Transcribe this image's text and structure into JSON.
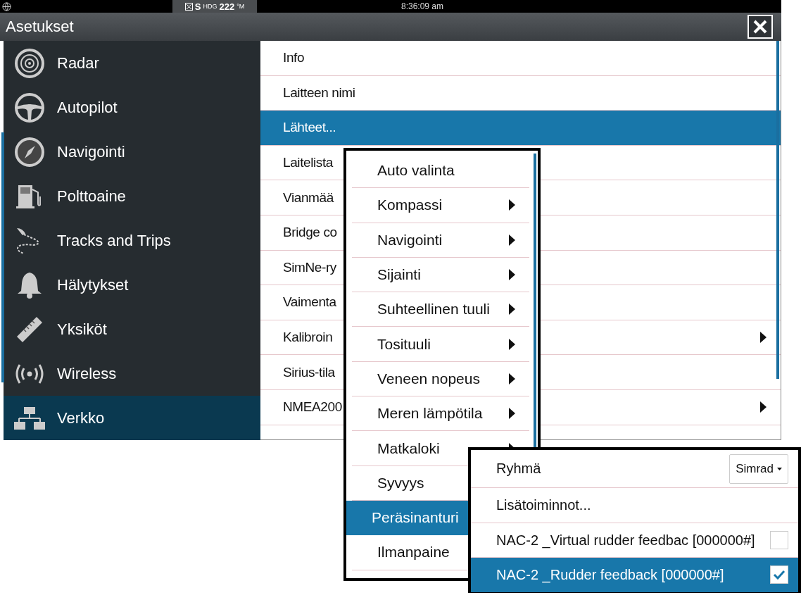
{
  "status_bar": {
    "heading_source": "S",
    "heading_label": "HDG",
    "heading_value": "222",
    "heading_unit": "°M",
    "time": "8:36:09 am"
  },
  "window": {
    "title": "Asetukset"
  },
  "sidebar": {
    "items": [
      {
        "label": "Radar",
        "selected": false
      },
      {
        "label": "Autopilot",
        "selected": false
      },
      {
        "label": "Navigointi",
        "selected": false
      },
      {
        "label": "Polttoaine",
        "selected": false
      },
      {
        "label": "Tracks and Trips",
        "selected": false
      },
      {
        "label": "Hälytykset",
        "selected": false
      },
      {
        "label": "Yksiköt",
        "selected": false
      },
      {
        "label": "Wireless",
        "selected": false
      },
      {
        "label": "Verkko",
        "selected": true
      }
    ]
  },
  "settings": {
    "items": [
      {
        "label": "Info",
        "selected": false,
        "submenu": false
      },
      {
        "label": "Laitteen nimi",
        "selected": false,
        "submenu": false
      },
      {
        "label": "Lähteet...",
        "selected": true,
        "submenu": false
      },
      {
        "label": "Laitelista",
        "selected": false,
        "submenu": false
      },
      {
        "label": "Vianmää",
        "selected": false,
        "submenu": false
      },
      {
        "label": "Bridge co",
        "selected": false,
        "submenu": false
      },
      {
        "label": "SimNe-ry",
        "selected": false,
        "submenu": false
      },
      {
        "label": "Vaimenta",
        "selected": false,
        "submenu": false
      },
      {
        "label": "Kalibroin",
        "selected": false,
        "submenu": true
      },
      {
        "label": "Sirius-tila",
        "selected": false,
        "submenu": false
      },
      {
        "label": "NMEA200",
        "selected": false,
        "submenu": true
      }
    ]
  },
  "sources_menu": {
    "items": [
      {
        "label": "Auto valinta",
        "selected": false,
        "submenu": false
      },
      {
        "label": "Kompassi",
        "selected": false,
        "submenu": true
      },
      {
        "label": "Navigointi",
        "selected": false,
        "submenu": true
      },
      {
        "label": "Sijainti",
        "selected": false,
        "submenu": true
      },
      {
        "label": "Suhteellinen tuuli",
        "selected": false,
        "submenu": true
      },
      {
        "label": "Tosituuli",
        "selected": false,
        "submenu": true
      },
      {
        "label": "Veneen nopeus",
        "selected": false,
        "submenu": true
      },
      {
        "label": "Meren lämpötila",
        "selected": false,
        "submenu": true
      },
      {
        "label": "Matkaloki",
        "selected": false,
        "submenu": true
      },
      {
        "label": "Syvyys",
        "selected": false
      },
      {
        "label": "Peräsinanturi",
        "selected": true
      },
      {
        "label": "Ilmanpaine",
        "selected": false
      }
    ]
  },
  "rudder_menu": {
    "items": [
      {
        "kind": "dropdown",
        "label": "Ryhmä",
        "value": "Simrad"
      },
      {
        "kind": "action",
        "label": "Lisätoiminnot..."
      },
      {
        "kind": "source",
        "label": "NAC-2 _Virtual rudder feedbac [000000#]",
        "selected": false,
        "checked": false
      },
      {
        "kind": "source",
        "label": "NAC-2 _Rudder feedback [000000#]",
        "selected": true,
        "checked": true
      }
    ]
  }
}
